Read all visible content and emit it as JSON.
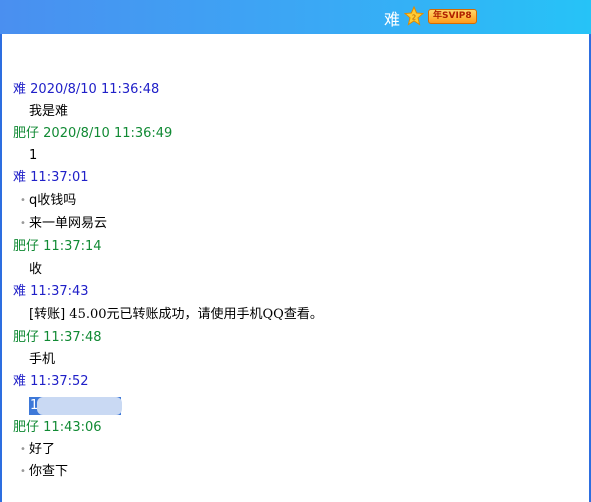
{
  "header": {
    "contact_name": "难",
    "icons": [
      "star-icon"
    ],
    "vip_badge": "年SVIP8",
    "colors": {
      "gradient_start": "#4a8ff0",
      "gradient_end": "#26c3f7",
      "border": "#2d6ee0"
    }
  },
  "chat": {
    "messages": [
      {
        "sender": "难",
        "time": "2020/8/10 11:36:48",
        "lines": [
          "我是难"
        ]
      },
      {
        "sender": "肥仔",
        "time": "2020/8/10 11:36:49",
        "lines": [
          "1"
        ]
      },
      {
        "sender": "难",
        "time": "11:37:01",
        "lines": [
          "q收钱吗",
          "来一单网易云"
        ]
      },
      {
        "sender": "肥仔",
        "time": "11:37:14",
        "lines": [
          "收"
        ]
      },
      {
        "sender": "难",
        "time": "11:37:43",
        "lines": [
          "[转账]",
          "45.00元已转账成功，请使用手机QQ查看。"
        ]
      },
      {
        "sender": "肥仔",
        "time": "11:37:48",
        "lines": [
          "手机"
        ]
      },
      {
        "sender": "难",
        "time": "11:37:52",
        "lines": [
          "1"
        ]
      },
      {
        "sender": "肥仔",
        "time": "11:43:06",
        "lines": [
          "好了",
          "你查下"
        ]
      }
    ],
    "colors": {
      "self_name": "#2020c8",
      "other_name": "#118a34",
      "selection": "#3d78d8"
    }
  }
}
